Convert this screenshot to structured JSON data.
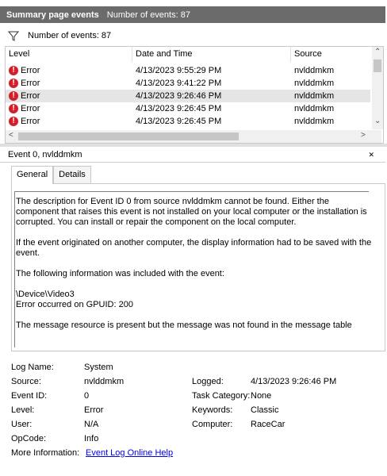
{
  "title": {
    "label": "Summary page events",
    "count": "Number of events: 87"
  },
  "filter": {
    "label": "Number of events: 87"
  },
  "columns": [
    "Level",
    "Date and Time",
    "Source"
  ],
  "rows": [
    {
      "level": "Error",
      "datetime": "4/13/2023 9:55:29 PM",
      "source": "nvlddmkm"
    },
    {
      "level": "Error",
      "datetime": "4/13/2023 9:41:22 PM",
      "source": "nvlddmkm"
    },
    {
      "level": "Error",
      "datetime": "4/13/2023 9:26:46 PM",
      "source": "nvlddmkm"
    },
    {
      "level": "Error",
      "datetime": "4/13/2023 9:26:45 PM",
      "source": "nvlddmkm"
    },
    {
      "level": "Error",
      "datetime": "4/13/2023 9:26:45 PM",
      "source": "nvlddmkm"
    }
  ],
  "event": {
    "header": "Event 0, nvlddmkm"
  },
  "tabs": [
    "General",
    "Details"
  ],
  "description": {
    "p1": "The description for Event ID 0 from source nvlddmkm cannot be found. Either the component that raises this event is not installed on your local computer or the installation is corrupted. You can install or repair the component on the local computer.",
    "p2": "If the event originated on another computer, the display information had to be saved with the event.",
    "p3": "The following information was included with the event:",
    "p4a": "\\Device\\Video3",
    "p4b": "Error occurred on GPUID: 200",
    "p5": "The message resource is present but the message was not found in the message table"
  },
  "details": {
    "log_name_label": "Log Name:",
    "log_name": "System",
    "source_label": "Source:",
    "source": "nvlddmkm",
    "logged_label": "Logged:",
    "logged": "4/13/2023 9:26:46 PM",
    "event_id_label": "Event ID:",
    "event_id": "0",
    "task_category_label": "Task Category:",
    "task_category": "None",
    "level_label": "Level:",
    "level": "Error",
    "keywords_label": "Keywords:",
    "keywords": "Classic",
    "user_label": "User:",
    "user": "N/A",
    "computer_label": "Computer:",
    "computer": "RaceCar",
    "opcode_label": "OpCode:",
    "opcode": "Info",
    "more_info_label": "More Information:",
    "more_info_link": "Event Log Online Help"
  },
  "colors": {
    "title_bg": "#6b6b6b",
    "error_red": "#d21f2a",
    "link_blue": "#0000ee",
    "selected_row": "#e5e5e5"
  },
  "icons": [
    "filter-icon",
    "error-icon",
    "scroll-up-icon",
    "scroll-down-icon",
    "scroll-left-icon",
    "scroll-right-icon",
    "close-icon"
  ]
}
